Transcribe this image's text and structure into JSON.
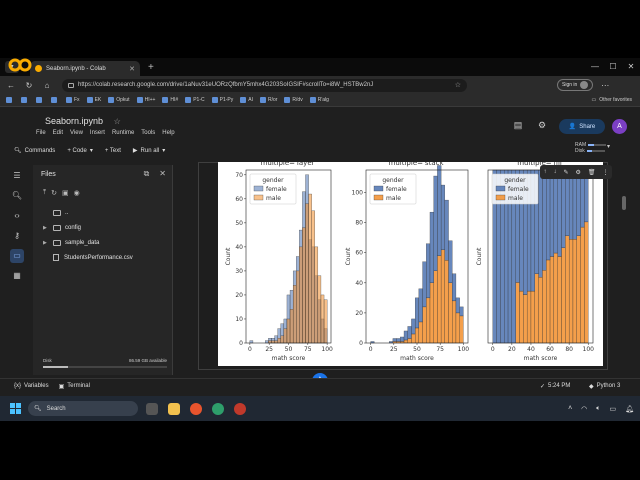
{
  "browser": {
    "tab_title": "Seaborn.ipynb - Colab",
    "url": "https://colab.research.google.com/drive/1aNuv31eUORzQfbmY5mhx4G203SoIGSIF#scrollTo=i8W_HSTBw2nJ",
    "signin_label": "Sign in",
    "bookmarks": [
      "",
      "",
      "",
      "",
      "Fx",
      "EK",
      "Opkut",
      "HI++",
      "HI#",
      "P1-C",
      "P1-Py",
      "AI",
      "R/or",
      "R/dv",
      "R'alg"
    ],
    "other_bookmarks": "Other favorites"
  },
  "colab": {
    "title": "Seaborn.ipynb",
    "menu": [
      "File",
      "Edit",
      "View",
      "Insert",
      "Runtime",
      "Tools",
      "Help"
    ],
    "share_label": "Share",
    "user_initial": "A",
    "toolbar": {
      "commands": "Commands",
      "code": "+ Code",
      "text": "+ Text",
      "run_all": "Run all"
    },
    "ram_label": "RAM",
    "disk_label": "Disk"
  },
  "files_panel": {
    "title": "Files",
    "items": [
      "..",
      "config",
      "sample_data",
      "StudentsPerformance.csv"
    ],
    "disk_label": "Disk",
    "disk_available": "86.59 GB available"
  },
  "status": {
    "variables": "Variables",
    "terminal": "Terminal",
    "time": "5:24 PM",
    "kernel": "Python 3"
  },
  "taskbar": {
    "search_label": "Search"
  },
  "chart_data": [
    {
      "type": "bar",
      "subtype": "histogram-layer",
      "title": "multiple='layer'",
      "xlabel": "math score",
      "ylabel": "Count",
      "xlim": [
        -5,
        105
      ],
      "ylim": [
        0,
        72
      ],
      "xticks": [
        0,
        25,
        50,
        75,
        100
      ],
      "yticks": [
        0,
        10,
        20,
        30,
        40,
        50,
        60,
        70
      ],
      "legend_title": "gender",
      "legend_loc": "upper left",
      "bin_edges": [
        0,
        4,
        8,
        12,
        16,
        20,
        24,
        28,
        32,
        36,
        40,
        44,
        48,
        52,
        56,
        60,
        64,
        68,
        72,
        76,
        80,
        84,
        88,
        92,
        96,
        100
      ],
      "series": [
        {
          "name": "female",
          "color": "#4c72b0",
          "values": [
            1,
            0,
            0,
            0,
            0,
            1,
            2,
            2,
            3,
            6,
            8,
            10,
            20,
            22,
            30,
            36,
            47,
            63,
            70,
            43,
            40,
            28,
            18,
            10,
            6
          ]
        },
        {
          "name": "male",
          "color": "#f28e2b",
          "values": [
            0,
            0,
            0,
            0,
            0,
            0,
            1,
            1,
            1,
            2,
            3,
            6,
            10,
            14,
            24,
            30,
            40,
            48,
            58,
            62,
            55,
            40,
            28,
            20,
            18
          ]
        }
      ]
    },
    {
      "type": "bar",
      "subtype": "histogram-stack",
      "title": "multiple='stack'",
      "xlabel": "math score",
      "ylabel": "Count",
      "xlim": [
        -5,
        105
      ],
      "ylim": [
        0,
        115
      ],
      "xticks": [
        0,
        25,
        50,
        75,
        100
      ],
      "yticks": [
        0,
        20,
        40,
        60,
        80,
        100
      ],
      "legend_title": "gender",
      "legend_loc": "upper left",
      "bin_edges": [
        0,
        4,
        8,
        12,
        16,
        20,
        24,
        28,
        32,
        36,
        40,
        44,
        48,
        52,
        56,
        60,
        64,
        68,
        72,
        76,
        80,
        84,
        88,
        92,
        96,
        100
      ],
      "series": [
        {
          "name": "male",
          "color": "#f28e2b",
          "values": [
            0,
            0,
            0,
            0,
            0,
            0,
            1,
            1,
            1,
            2,
            3,
            6,
            10,
            14,
            24,
            30,
            40,
            48,
            58,
            62,
            55,
            40,
            28,
            20,
            18
          ]
        },
        {
          "name": "female",
          "color": "#4c72b0",
          "values": [
            1,
            0,
            0,
            0,
            0,
            1,
            2,
            2,
            3,
            6,
            8,
            10,
            20,
            22,
            30,
            36,
            47,
            63,
            60,
            43,
            40,
            28,
            18,
            10,
            6
          ]
        }
      ]
    },
    {
      "type": "bar",
      "subtype": "histogram-fill",
      "title": "multiple='fill'",
      "xlabel": "math score",
      "ylabel": "Count",
      "xlim": [
        -5,
        105
      ],
      "ylim": [
        0,
        1
      ],
      "xticks": [
        0,
        20,
        40,
        60,
        80,
        100
      ],
      "legend_title": "gender",
      "legend_loc": "upper left",
      "bin_edges": [
        0,
        4,
        8,
        12,
        16,
        20,
        24,
        28,
        32,
        36,
        40,
        44,
        48,
        52,
        56,
        60,
        64,
        68,
        72,
        76,
        80,
        84,
        88,
        92,
        96,
        100
      ],
      "series": [
        {
          "name": "male",
          "color": "#f28e2b",
          "values": [
            0,
            0,
            0,
            0,
            0,
            0,
            0.35,
            0.3,
            0.28,
            0.3,
            0.3,
            0.4,
            0.38,
            0.42,
            0.48,
            0.5,
            0.52,
            0.5,
            0.55,
            0.62,
            0.6,
            0.6,
            0.62,
            0.67,
            0.7
          ]
        },
        {
          "name": "female",
          "color": "#4c72b0",
          "values": [
            1,
            1,
            1,
            1,
            1,
            1,
            0.65,
            0.7,
            0.72,
            0.7,
            0.7,
            0.6,
            0.62,
            0.58,
            0.52,
            0.5,
            0.48,
            0.5,
            0.45,
            0.38,
            0.4,
            0.4,
            0.38,
            0.33,
            0.3
          ]
        }
      ]
    }
  ]
}
